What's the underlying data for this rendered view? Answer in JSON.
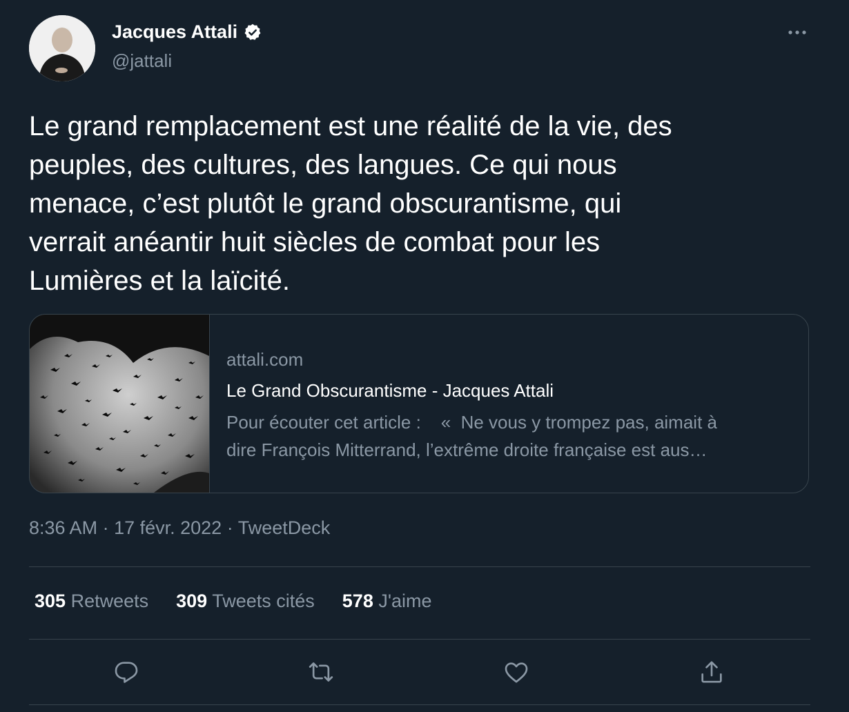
{
  "author": {
    "name": "Jacques Attali",
    "handle": "@jattali",
    "verified_icon": "verified-badge-icon"
  },
  "tweet": {
    "text": "Le grand remplacement est une réalité de la vie, des\npeuples, des cultures, des langues. Ce qui nous\nmenace, c’est plutôt le grand obscurantisme, qui\nverrait anéantir huit siècles de combat pour les\nLumières et la laïcité."
  },
  "card": {
    "domain": "attali.com",
    "title": "Le Grand Obscurantisme - Jacques Attali",
    "description": "Pour écouter cet article :    «  Ne vous y trompez pas, aimait à\ndire François Mitterrand, l’extrême droite française est aus…"
  },
  "meta": {
    "time": "8:36 AM",
    "separator": " · ",
    "date": "17 févr. 2022",
    "source": "TweetDeck"
  },
  "stats": {
    "retweets_count": "305",
    "retweets_label": "Retweets",
    "quotes_count": "309",
    "quotes_label": "Tweets cités",
    "likes_count": "578",
    "likes_label": "J'aime"
  },
  "colors": {
    "background": "#15202b",
    "text_primary": "#ffffff",
    "text_secondary": "#8b98a5",
    "border": "#38444d"
  }
}
